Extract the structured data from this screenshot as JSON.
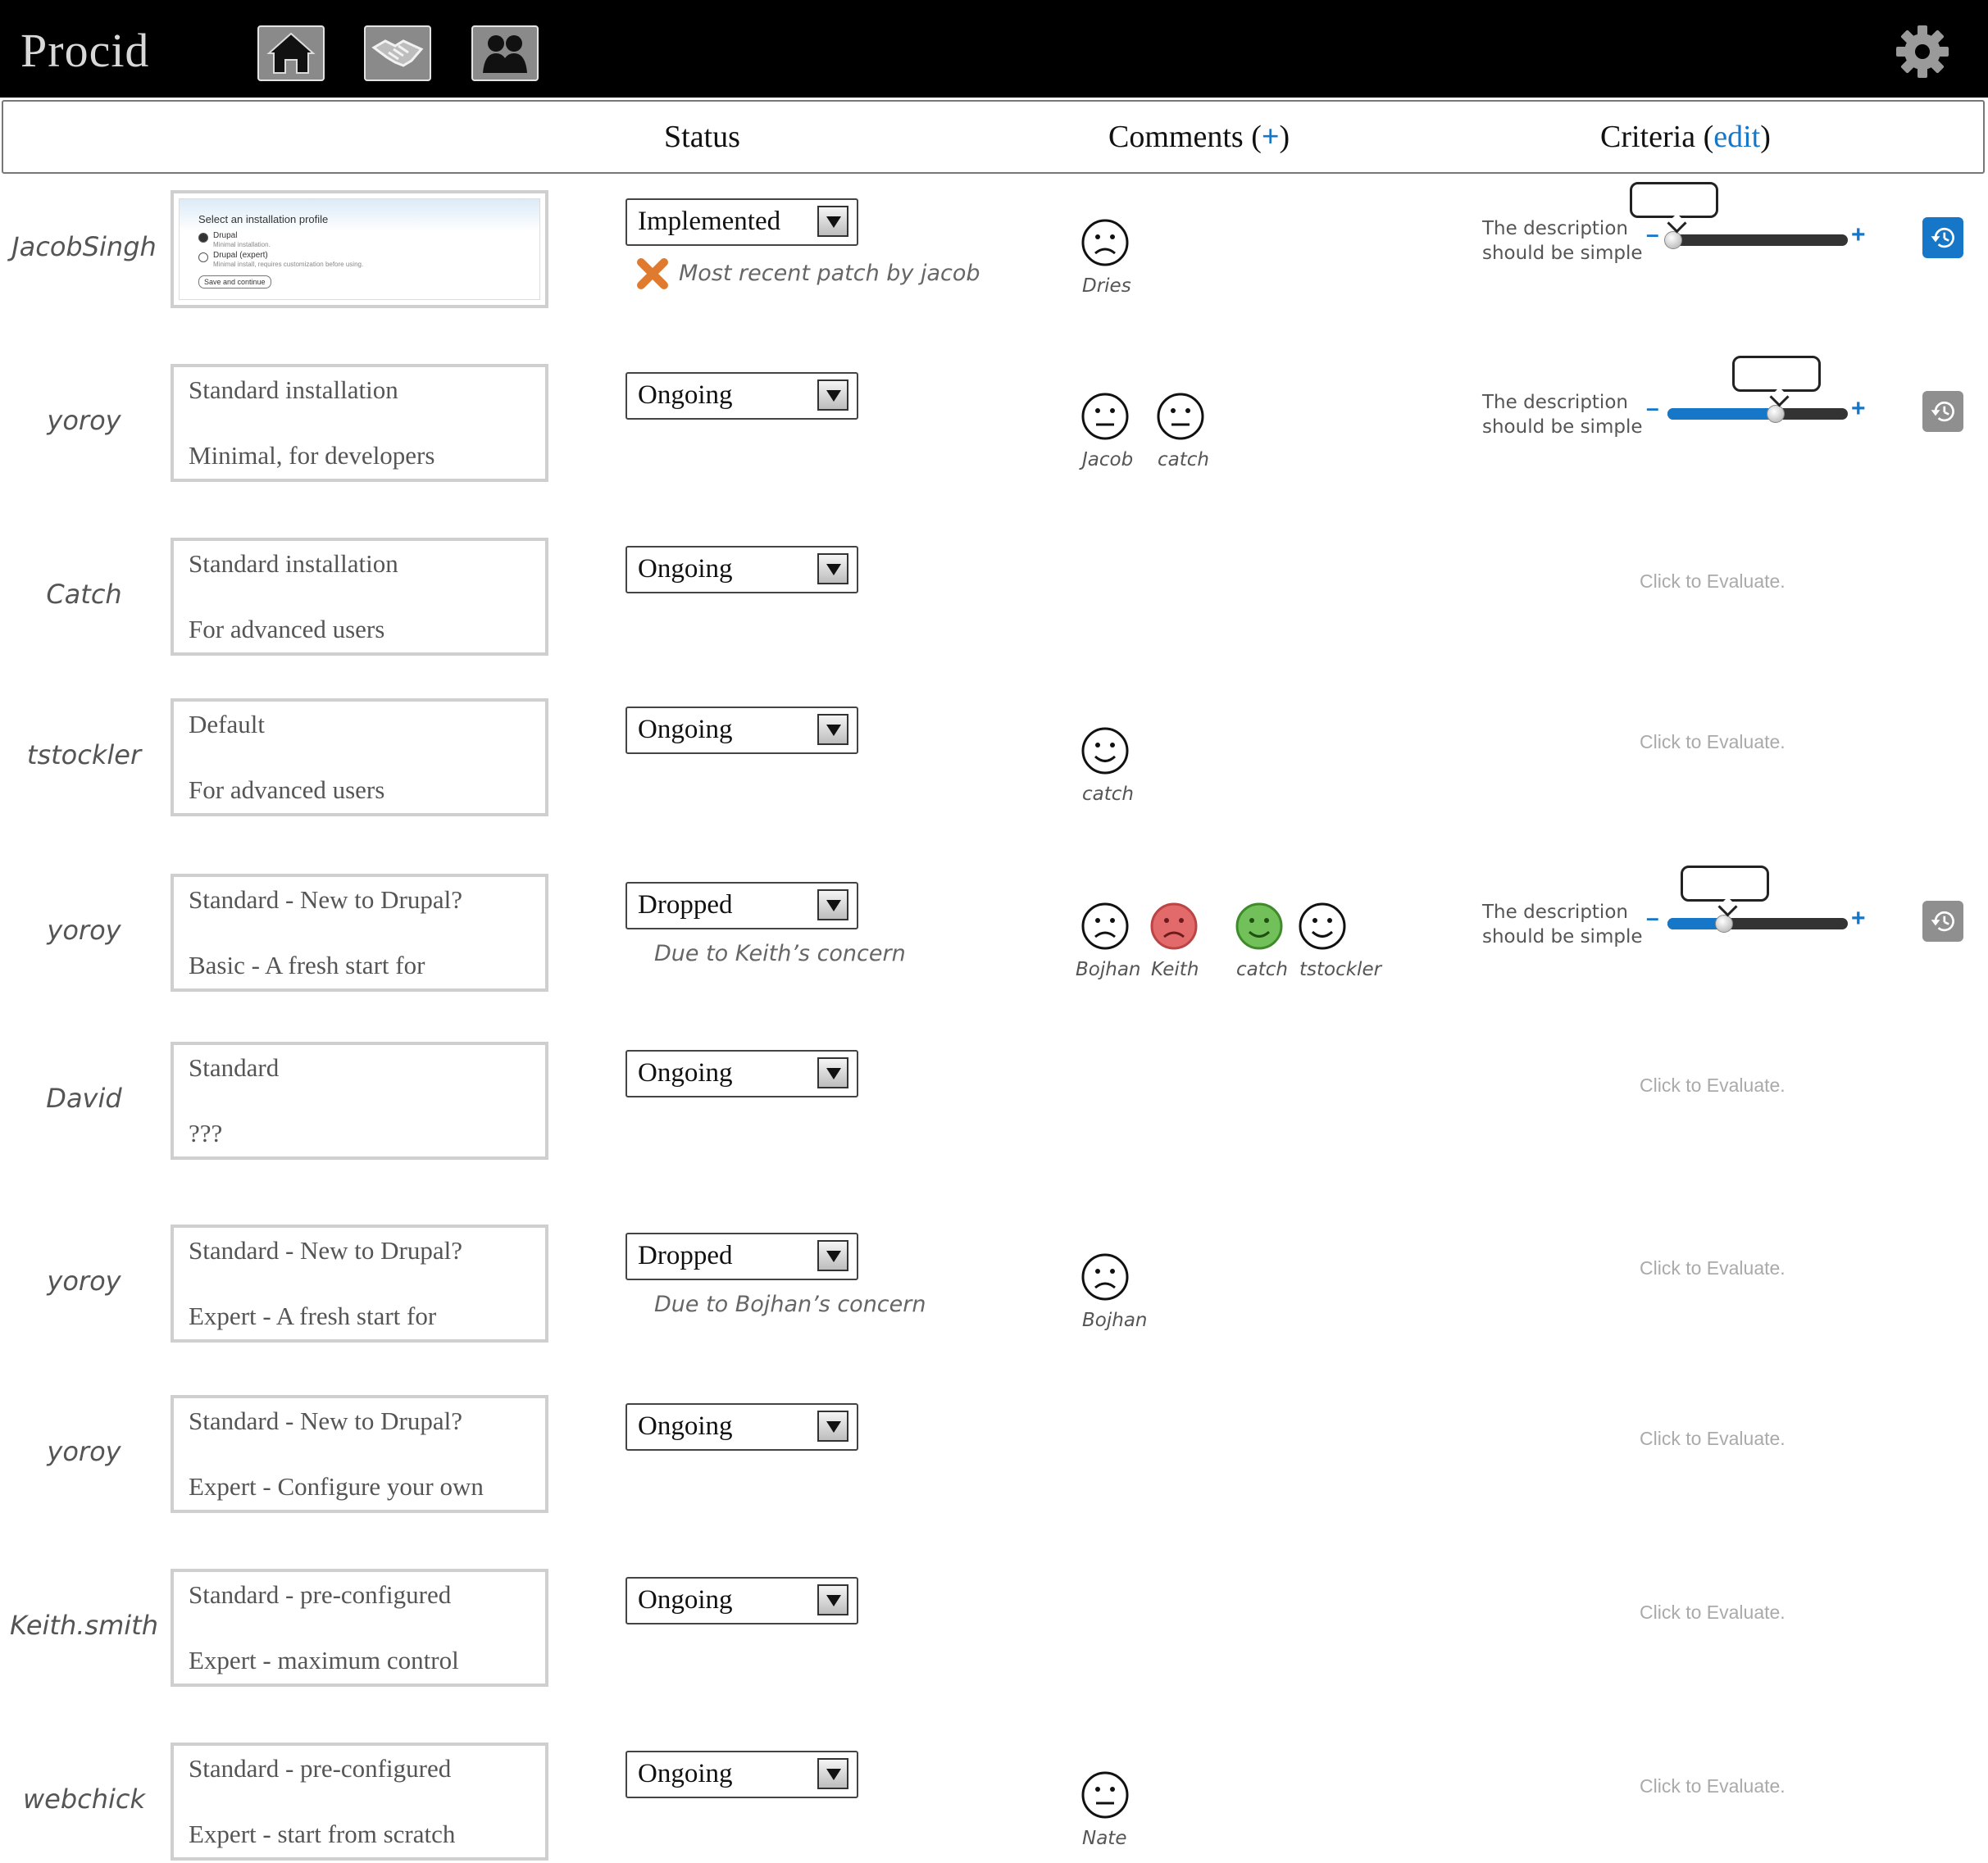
{
  "app": {
    "title": "Procid",
    "nav": [
      {
        "icon": "home-icon"
      },
      {
        "icon": "handshake-icon"
      },
      {
        "icon": "people-icon"
      }
    ],
    "settings_icon": "gear-icon"
  },
  "columns": {
    "status": "Status",
    "comments_label": "Comments",
    "comments_open": "(",
    "comments_plus": "+",
    "comments_close": ")",
    "criteria_label": "Criteria",
    "criteria_open": "(",
    "criteria_edit": "edit",
    "criteria_close": ")"
  },
  "colors": {
    "accent": "#1677c9",
    "sad_red": "#e26a6a",
    "happy_green": "#72c05a"
  },
  "screenshot_preview": {
    "title": "Select an installation profile",
    "opt1": "Drupal",
    "opt1_desc": "Minimal installation.",
    "opt2": "Drupal (expert)",
    "opt2_desc": "Minimal install, requires customization before using.",
    "button": "Save and continue"
  },
  "rows": [
    {
      "user": "JacobSingh",
      "status": "Implemented",
      "note": "Most recent patch by jacob",
      "note_icon": "x-cross-icon",
      "comments": [
        {
          "mood": "sad",
          "name": "Dries"
        }
      ],
      "criteria": {
        "text1": "The description",
        "text2": "should be simple",
        "value": 0.0,
        "history_icon": "history-icon-blue"
      }
    },
    {
      "user": "yoroy",
      "line1": "Standard installation",
      "line2": "Minimal, for developers",
      "status": "Ongoing",
      "comments": [
        {
          "mood": "neutral",
          "name": "Jacob"
        },
        {
          "mood": "neutral",
          "name": "catch"
        }
      ],
      "criteria": {
        "text1": "The description",
        "text2": "should be simple",
        "value": 0.6,
        "history_icon": "history-icon-gray"
      }
    },
    {
      "user": "Catch",
      "line1": "Standard installation",
      "line2": "For advanced users",
      "status": "Ongoing",
      "comments": [],
      "evaluate": "Click to Evaluate."
    },
    {
      "user": "tstockler",
      "line1": "Default",
      "line2": "For advanced users",
      "status": "Ongoing",
      "comments": [
        {
          "mood": "happy",
          "name": "catch"
        }
      ],
      "evaluate": "Click to Evaluate."
    },
    {
      "user": "yoroy",
      "line1": "Standard - New to Drupal?",
      "line2": "Basic - A fresh start for",
      "status": "Dropped",
      "note": "Due to Keith’s concern",
      "comments": [
        {
          "mood": "sad",
          "name": "Bojhan"
        },
        {
          "mood": "sad-red",
          "name": "Keith"
        },
        {
          "mood": "happy-green",
          "name": "catch"
        },
        {
          "mood": "happy",
          "name": "tstockler"
        }
      ],
      "criteria": {
        "text1": "The description",
        "text2": "should be simple",
        "value": 0.3,
        "history_icon": "history-icon-gray"
      }
    },
    {
      "user": "David",
      "line1": "Standard",
      "line2": "???",
      "status": "Ongoing",
      "comments": [],
      "evaluate": "Click to Evaluate."
    },
    {
      "user": "yoroy",
      "line1": "Standard - New to Drupal?",
      "line2": "Expert - A fresh start for",
      "status": "Dropped",
      "note": "Due to Bojhan’s concern",
      "comments": [
        {
          "mood": "sad",
          "name": "Bojhan"
        }
      ],
      "evaluate": "Click to Evaluate."
    },
    {
      "user": "yoroy",
      "line1": "Standard - New to Drupal?",
      "line2": "Expert - Configure your own",
      "status": "Ongoing",
      "comments": [],
      "evaluate": "Click to Evaluate."
    },
    {
      "user": "Keith.smith",
      "line1": "Standard - pre-configured",
      "line2": "Expert - maximum control",
      "status": "Ongoing",
      "comments": [],
      "evaluate": "Click to Evaluate."
    },
    {
      "user": "webchick",
      "line1": "Standard - pre-configured",
      "line2": "Expert - start from scratch",
      "status": "Ongoing",
      "comments": [
        {
          "mood": "neutral",
          "name": "Nate"
        }
      ],
      "evaluate": "Click to Evaluate."
    }
  ]
}
